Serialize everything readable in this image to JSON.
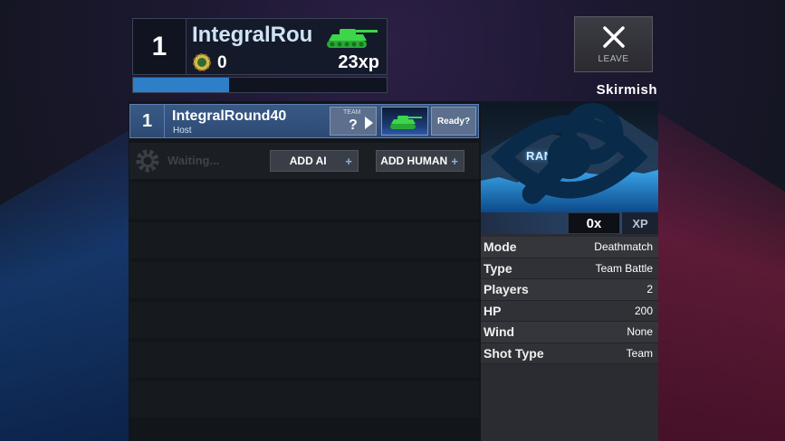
{
  "header": {
    "rank": "1",
    "player_name": "IntegralRou",
    "coins": "0",
    "xp": "23xp",
    "xp_progress": 0.38
  },
  "leave": {
    "label": "LEAVE"
  },
  "mode_title": "Skirmish",
  "lobby": {
    "player": {
      "rank": "1",
      "name": "IntegralRound40",
      "role": "Host",
      "team_label": "TEAM",
      "team_value": "?",
      "ready_label": "Ready?"
    },
    "waiting_text": "Waiting...",
    "add_ai_label": "ADD AI",
    "add_human_label": "ADD HUMAN",
    "plus_symbol": "+"
  },
  "map": {
    "title": "RANDOM MAP",
    "multiplier": "0x",
    "xp_label": "XP"
  },
  "settings": [
    {
      "key": "Mode",
      "value": "Deathmatch"
    },
    {
      "key": "Type",
      "value": "Team Battle"
    },
    {
      "key": "Players",
      "value": "2"
    },
    {
      "key": "HP",
      "value": "200"
    },
    {
      "key": "Wind",
      "value": "None"
    },
    {
      "key": "Shot Type",
      "value": "Team"
    }
  ],
  "colors": {
    "accent_blue": "#2f7fc8",
    "tank_green": "#3dd64a",
    "player_row": "#3a5a86"
  },
  "icons": [
    "tank-icon",
    "coin-icon",
    "close-icon",
    "arrow-right-icon",
    "gear-icon",
    "plus-icon",
    "eye-icon",
    "wrench-icon"
  ]
}
